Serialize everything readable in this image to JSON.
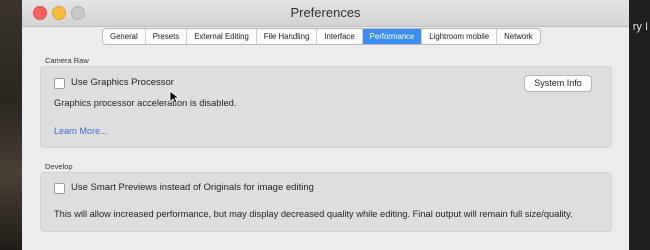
{
  "window": {
    "title": "Preferences"
  },
  "background_text": "ry I",
  "tabs": [
    {
      "label": "General",
      "active": false
    },
    {
      "label": "Presets",
      "active": false
    },
    {
      "label": "External Editing",
      "active": false
    },
    {
      "label": "File Handling",
      "active": false
    },
    {
      "label": "Interface",
      "active": false
    },
    {
      "label": "Performance",
      "active": true
    },
    {
      "label": "Lightroom mobile",
      "active": false
    },
    {
      "label": "Network",
      "active": false
    }
  ],
  "camera_raw": {
    "group_label": "Camera Raw",
    "use_gpu_label": "Use Graphics Processor",
    "use_gpu_checked": false,
    "system_info_label": "System Info",
    "status_text": "Graphics processor acceleration is disabled.",
    "learn_more_label": "Learn More..."
  },
  "develop": {
    "group_label": "Develop",
    "smart_previews_label": "Use Smart Previews instead of Originals for image editing",
    "smart_previews_checked": false,
    "description": "This will allow increased performance, but may display decreased quality while editing. Final output will remain full size/quality."
  },
  "colors": {
    "accent": "#3b8ef3",
    "link": "#3b6fd6",
    "window_bg": "#ececec",
    "group_bg": "#dedede"
  }
}
